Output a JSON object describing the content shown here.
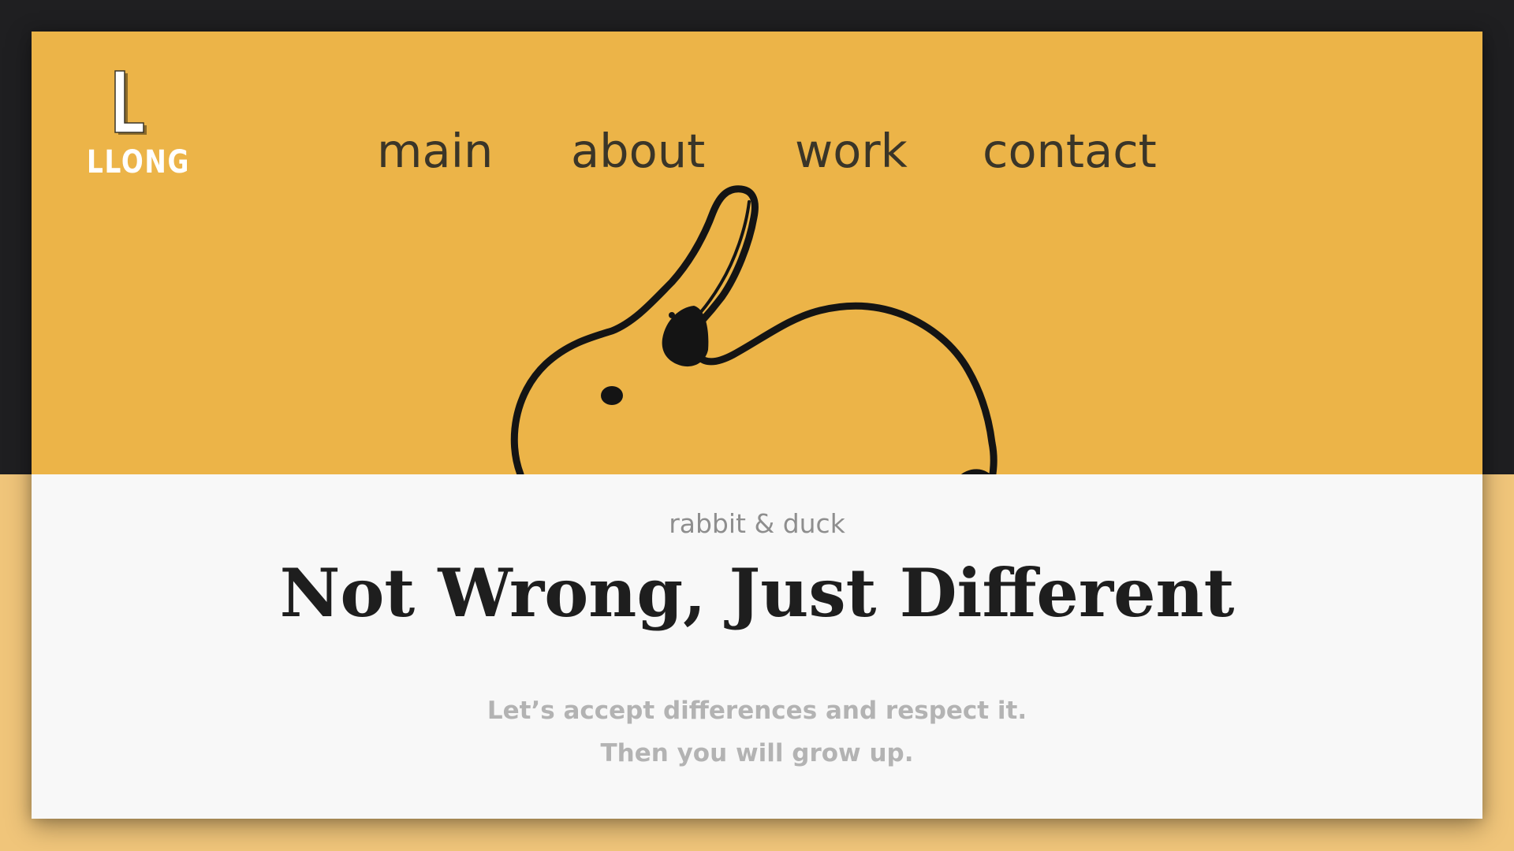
{
  "brand": {
    "logo_mark": "L",
    "name": "LLONG"
  },
  "nav": {
    "items": [
      {
        "label": "main"
      },
      {
        "label": "about"
      },
      {
        "label": "work"
      },
      {
        "label": "contact"
      }
    ]
  },
  "hero": {
    "illustration": "rabbit-duck-illustration",
    "background_color": "#ecb448"
  },
  "content": {
    "eyebrow": "rabbit & duck",
    "headline": "Not Wrong,  Just Different",
    "subtext_line1": "Let’s accept differences and respect it.",
    "subtext_line2": "Then you will grow up."
  },
  "colors": {
    "page_top": "#1f1f21",
    "page_bottom": "#f0c57a",
    "card": "#f8f8f8",
    "accent": "#ecb448"
  }
}
